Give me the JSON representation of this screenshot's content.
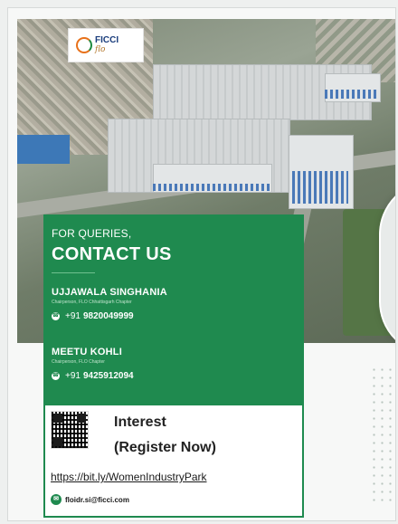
{
  "logo": {
    "brand": "FICCI",
    "sub": "flo"
  },
  "contact": {
    "heading_small": "FOR QUERIES,",
    "heading_large": "CONTACT US",
    "people": [
      {
        "name": "UJJAWALA SINGHANIA",
        "role": "Chairperson, FLO Chhattisgarh Chapter",
        "phone_prefix": "+91",
        "phone_number": "9820049999"
      },
      {
        "name": "MEETU KOHLI",
        "role": "Chairperson, FLO Chapter",
        "phone_prefix": "+91",
        "phone_number": "9425912094"
      }
    ]
  },
  "register": {
    "line1": "Interest",
    "line2": "(Register Now)",
    "link": "https://bit.ly/WomenIndustryPark",
    "email": "floidr.si@ficci.com"
  },
  "colors": {
    "green": "#1f8a4f",
    "brand_blue": "#1a3d7c",
    "brand_orange": "#e8711a"
  },
  "icons": {
    "phone": "phone-icon",
    "email": "email-icon",
    "qr": "qr-code-icon"
  }
}
